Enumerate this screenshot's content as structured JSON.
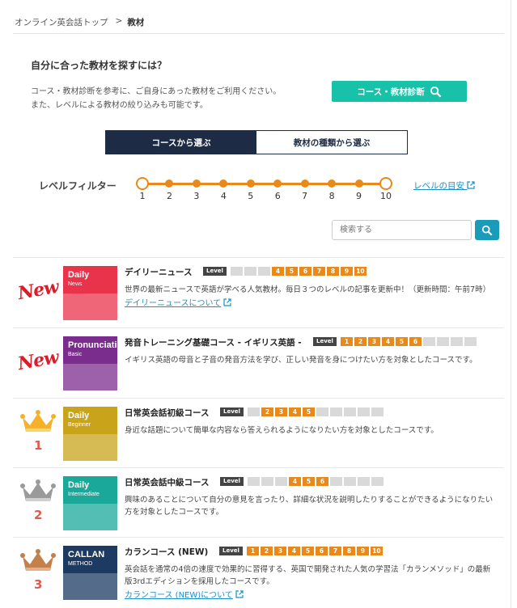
{
  "breadcrumb": {
    "home": "オンライン英会話トップ",
    "separator": ">",
    "current": "教材"
  },
  "intro": {
    "title": "自分に合った教材を探すには？",
    "line1": "コース・教材診断を参考に、ご自身にあった教材をご利用ください。",
    "line2": "また、レベルによる教材の絞り込みも可能です。",
    "diagnose_button": "コース・教材診断"
  },
  "tabs": [
    {
      "label": "コースから選ぶ",
      "active": true
    },
    {
      "label": "教材の種類から選ぶ",
      "active": false
    }
  ],
  "level_filter": {
    "label": "レベルフィルター",
    "levels": [
      "1",
      "2",
      "3",
      "4",
      "5",
      "6",
      "7",
      "8",
      "9",
      "10"
    ],
    "min_selected": 1,
    "max_selected": 10,
    "guide_link": "レベルの目安"
  },
  "search": {
    "placeholder": "検索する"
  },
  "courses": [
    {
      "badge": "New",
      "thumb_line1": "Daily",
      "thumb_line2": "News",
      "thumb_color": "#e8334a",
      "title": "デイリーニュース",
      "level_tag": "Level",
      "levels": [
        "1",
        "2",
        "3",
        "4",
        "5",
        "6",
        "7",
        "8",
        "9",
        "10"
      ],
      "levels_on": [
        4,
        5,
        6,
        7,
        8,
        9,
        10
      ],
      "desc": "世界の最新ニュースで英語が学べる人気教材。毎日３つのレベルの記事を更新中！（更新時間：午前7時）",
      "link": "デイリーニュースについて"
    },
    {
      "badge": "New",
      "thumb_line1": "Pronunciation",
      "thumb_line2": "Basic",
      "thumb_color": "#7b2d8e",
      "title": "発音トレーニング基礎コース - イギリス英語 -",
      "level_tag": "Level",
      "levels": [
        "1",
        "2",
        "3",
        "4",
        "5",
        "6",
        "7",
        "8",
        "9",
        "10"
      ],
      "levels_on": [
        1,
        2,
        3,
        4,
        5,
        6
      ],
      "desc": "イギリス英語の母音と子音の発音方法を学び、正しい発音を身につけたい方を対象としたコースです。",
      "link": ""
    },
    {
      "rank": "1",
      "thumb_line1": "Daily",
      "thumb_line2": "Beginner",
      "thumb_color": "#c9a31a",
      "title": "日常英会話初級コース",
      "level_tag": "Level",
      "levels": [
        "1",
        "2",
        "3",
        "4",
        "5",
        "6",
        "7",
        "8",
        "9",
        "10"
      ],
      "levels_on": [
        2,
        3,
        4,
        5
      ],
      "desc": "身近な話題について簡単な内容なら答えられるようになりたい方を対象としたコースです。",
      "link": ""
    },
    {
      "rank": "2",
      "thumb_line1": "Daily",
      "thumb_line2": "Intermediate",
      "thumb_color": "#1aa89a",
      "title": "日常英会話中級コース",
      "level_tag": "Level",
      "levels": [
        "1",
        "2",
        "3",
        "4",
        "5",
        "6",
        "7",
        "8",
        "9",
        "10"
      ],
      "levels_on": [
        4,
        5,
        6
      ],
      "desc": "興味のあることについて自分の意見を言ったり、詳細な状況を説明したりすることができるようになりたい方を対象としたコースです。",
      "link": ""
    },
    {
      "rank": "3",
      "thumb_line1": "CALLAN",
      "thumb_line2": "METHOD",
      "thumb_color": "#1d3a63",
      "title": "カランコース (NEW)",
      "level_tag": "Level",
      "levels": [
        "1",
        "2",
        "3",
        "4",
        "5",
        "6",
        "7",
        "8",
        "9",
        "10"
      ],
      "levels_on": [
        1,
        2,
        3,
        4,
        5,
        6,
        7,
        8,
        9,
        10
      ],
      "desc": "英会話を通常の4倍の速度で効果的に習得する、英国で開発された人気の学習法「カランメソッド」の最新版3rdエディションを採用したコースです。",
      "link": "カランコース (NEW)について"
    }
  ],
  "colors": {
    "accent": "#e8891a",
    "teal": "#18c2a8",
    "navy": "#1d2b44",
    "link": "#1a8fc9"
  }
}
